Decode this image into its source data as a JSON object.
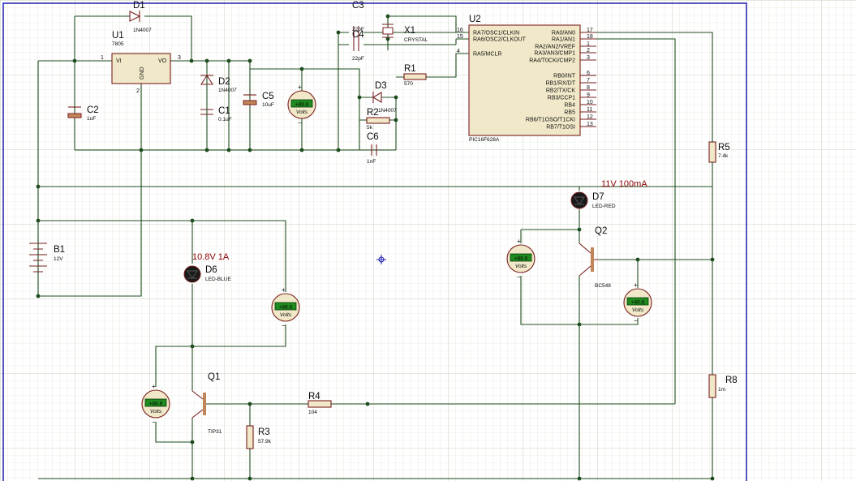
{
  "labels": {
    "d1": {
      "ref": "D1",
      "value": "1N4007"
    },
    "u1": {
      "ref": "U1",
      "value": "7805",
      "pin_in": "1",
      "pin_out": "3",
      "pin_gnd": "2",
      "vi": "VI",
      "vo": "VO",
      "gnd": "GND"
    },
    "d2": {
      "ref": "D2",
      "value": "1N4007"
    },
    "c1": {
      "ref": "C1",
      "value": "0.1uF"
    },
    "c2": {
      "ref": "C2",
      "value": "1uF"
    },
    "c5": {
      "ref": "C5",
      "value": "10uF"
    },
    "c3": {
      "ref": "C3",
      "value": "22pF"
    },
    "c4": {
      "ref": "C4",
      "value": "22pF"
    },
    "x1": {
      "ref": "X1",
      "value": "CRYSTAL"
    },
    "r1": {
      "ref": "R1",
      "value": "570"
    },
    "d3": {
      "ref": "D3",
      "value": "1N4007"
    },
    "r2": {
      "ref": "R2",
      "value": "5k"
    },
    "c6": {
      "ref": "C6",
      "value": "1nF"
    },
    "u2": {
      "ref": "U2",
      "value": "PIC16F628A"
    },
    "r5": {
      "ref": "R5",
      "value": "7.4k"
    },
    "r8": {
      "ref": "R8",
      "value": "1m"
    },
    "b1": {
      "ref": "B1",
      "value": "12V"
    },
    "d6": {
      "ref": "D6",
      "value": "LED-BLUE",
      "note": "10.8V 1A"
    },
    "d7": {
      "ref": "D7",
      "value": "LED-RED",
      "note": "11V 100mA"
    },
    "q1": {
      "ref": "Q1",
      "value": "TIP31"
    },
    "q2": {
      "ref": "Q2",
      "value": "BC548"
    },
    "r3": {
      "ref": "R3",
      "value": "57.9k"
    },
    "r4": {
      "ref": "R4",
      "value": "104"
    }
  },
  "u2_left_pins": [
    {
      "num": "16",
      "name": "RA7/OSC1/CLKIN"
    },
    {
      "num": "15",
      "name": "RA6/OSC2/CLKOUT"
    },
    {
      "num": "4",
      "name": "RA5/MCLR"
    }
  ],
  "u2_right_pins": [
    {
      "num": "17",
      "name": "RA0/AN0"
    },
    {
      "num": "18",
      "name": "RA1/AN1"
    },
    {
      "num": "1",
      "name": "RA2/AN2/VREF"
    },
    {
      "num": "2",
      "name": "RA3/AN3/CMP1"
    },
    {
      "num": "3",
      "name": "RA4/T0CKI/CMP2"
    },
    {
      "num": "6",
      "name": "RB0/INT"
    },
    {
      "num": "7",
      "name": "RB1/RX/DT"
    },
    {
      "num": "8",
      "name": "RB2/TX/CK"
    },
    {
      "num": "9",
      "name": "RB3/CCP1"
    },
    {
      "num": "10",
      "name": "RB4"
    },
    {
      "num": "11",
      "name": "RB5"
    },
    {
      "num": "12",
      "name": "RB6/T1OSO/T1CKI"
    },
    {
      "num": "13",
      "name": "RB7/T1OSI"
    }
  ],
  "voltmeter": {
    "unit": "Volts",
    "display": "+88.8"
  },
  "colors": {
    "grid": "#d6dbc8",
    "wire": "#1f4d1f",
    "part": "#7a1f1f",
    "body": "#f0e8c8",
    "note": "#8b0000",
    "border": "#1f1fb0"
  }
}
